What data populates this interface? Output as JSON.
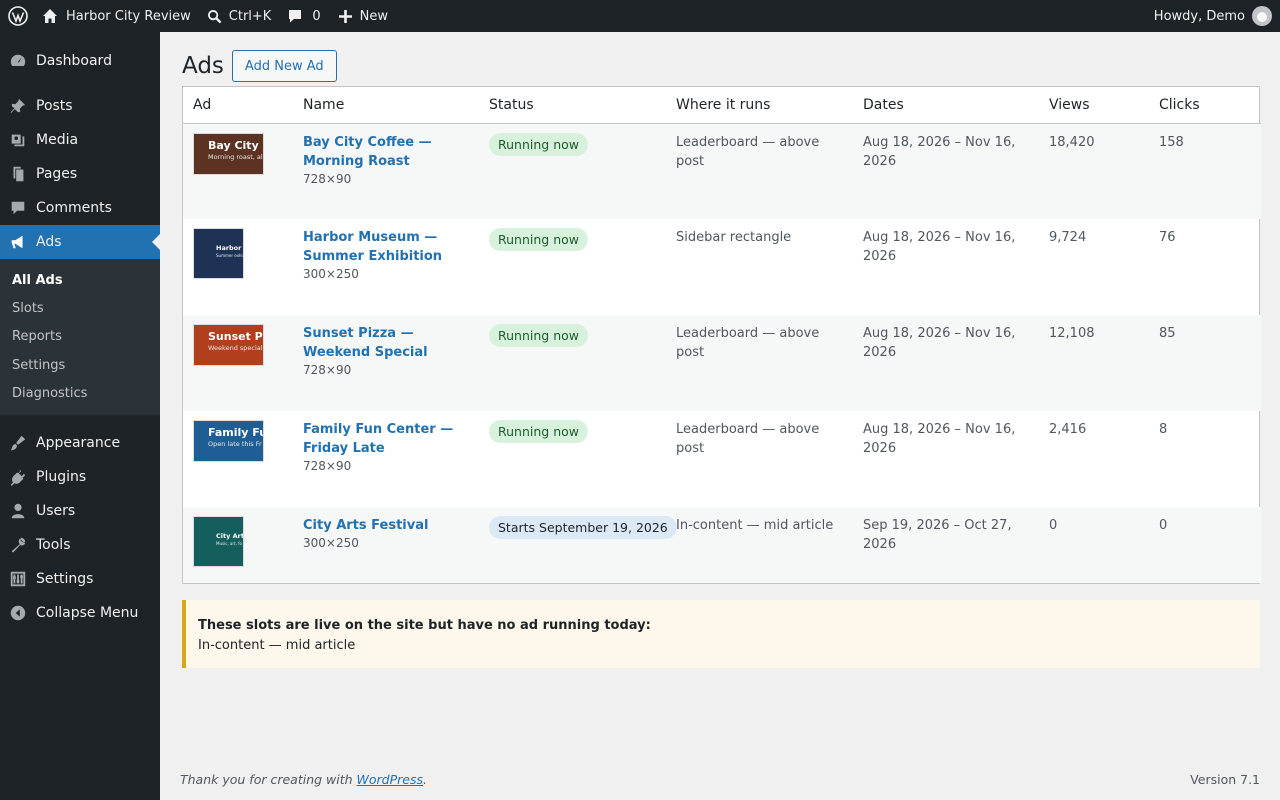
{
  "adminbar": {
    "site_name": "Harbor City Review",
    "search_shortcut": "Ctrl+K",
    "comments_count": "0",
    "new_label": "New",
    "howdy": "Howdy, Demo"
  },
  "sidebar": {
    "items": [
      {
        "label": "Dashboard",
        "icon": "dashboard-icon"
      },
      {
        "label": "Posts",
        "icon": "pushpin-icon"
      },
      {
        "label": "Media",
        "icon": "media-icon"
      },
      {
        "label": "Pages",
        "icon": "pages-icon"
      },
      {
        "label": "Comments",
        "icon": "comment-icon"
      },
      {
        "label": "Ads",
        "icon": "megaphone-icon"
      },
      {
        "label": "Appearance",
        "icon": "brush-icon"
      },
      {
        "label": "Plugins",
        "icon": "plug-icon"
      },
      {
        "label": "Users",
        "icon": "user-icon"
      },
      {
        "label": "Tools",
        "icon": "wrench-icon"
      },
      {
        "label": "Settings",
        "icon": "sliders-icon"
      },
      {
        "label": "Collapse Menu",
        "icon": "collapse-icon"
      }
    ],
    "submenu": [
      "All Ads",
      "Slots",
      "Reports",
      "Settings",
      "Diagnostics"
    ]
  },
  "page": {
    "title": "Ads",
    "add_button": "Add New Ad"
  },
  "table": {
    "columns": [
      "Ad",
      "Name",
      "Status",
      "Where it runs",
      "Dates",
      "Views",
      "Clicks"
    ],
    "rows": [
      {
        "thumb_title": "Bay City C",
        "thumb_sub": "Morning roast, al",
        "thumb_color": "#5c3323",
        "name": "Bay City Coffee — Morning Roast",
        "size": "728×90",
        "status": "Running now",
        "where": "Leaderboard — above post",
        "dates": "Aug 18, 2026 – Nov 16, 2026",
        "views": "18,420",
        "clicks": "158"
      },
      {
        "thumb_title": "Harbor M",
        "thumb_sub": "Summer exhi",
        "thumb_color": "#1e3256",
        "name": "Harbor Museum — Summer Exhibition",
        "size": "300×250",
        "status": "Running now",
        "where": "Sidebar rectangle",
        "dates": "Aug 18, 2026 – Nov 16, 2026",
        "views": "9,724",
        "clicks": "76"
      },
      {
        "thumb_title": "Sunset Pi",
        "thumb_sub": "Weekend special",
        "thumb_color": "#b13e1c",
        "name": "Sunset Pizza — Weekend Special",
        "size": "728×90",
        "status": "Running now",
        "where": "Leaderboard — above post",
        "dates": "Aug 18, 2026 – Nov 16, 2026",
        "views": "12,108",
        "clicks": "85"
      },
      {
        "thumb_title": "Family Fu",
        "thumb_sub": "Open late this Fr",
        "thumb_color": "#1f5e94",
        "name": "Family Fun Center — Friday Late",
        "size": "728×90",
        "status": "Running now",
        "where": "Leaderboard — above post",
        "dates": "Aug 18, 2026 – Nov 16, 2026",
        "views": "2,416",
        "clicks": "8"
      },
      {
        "thumb_title": "City Arts",
        "thumb_sub": "Music, art, fo",
        "thumb_color": "#155e5e",
        "name": "City Arts Festival",
        "size": "300×250",
        "status": "Starts September 19, 2026",
        "where": "In-content — mid article",
        "dates": "Sep 19, 2026 – Oct 27, 2026",
        "views": "0",
        "clicks": "0"
      }
    ]
  },
  "notice": {
    "title": "These slots are live on the site but have no ad running today:",
    "body": "In-content — mid article"
  },
  "footer": {
    "thanks_prefix": "Thank you for creating with ",
    "link": "WordPress",
    "suffix": ".",
    "version": "Version 7.1"
  }
}
